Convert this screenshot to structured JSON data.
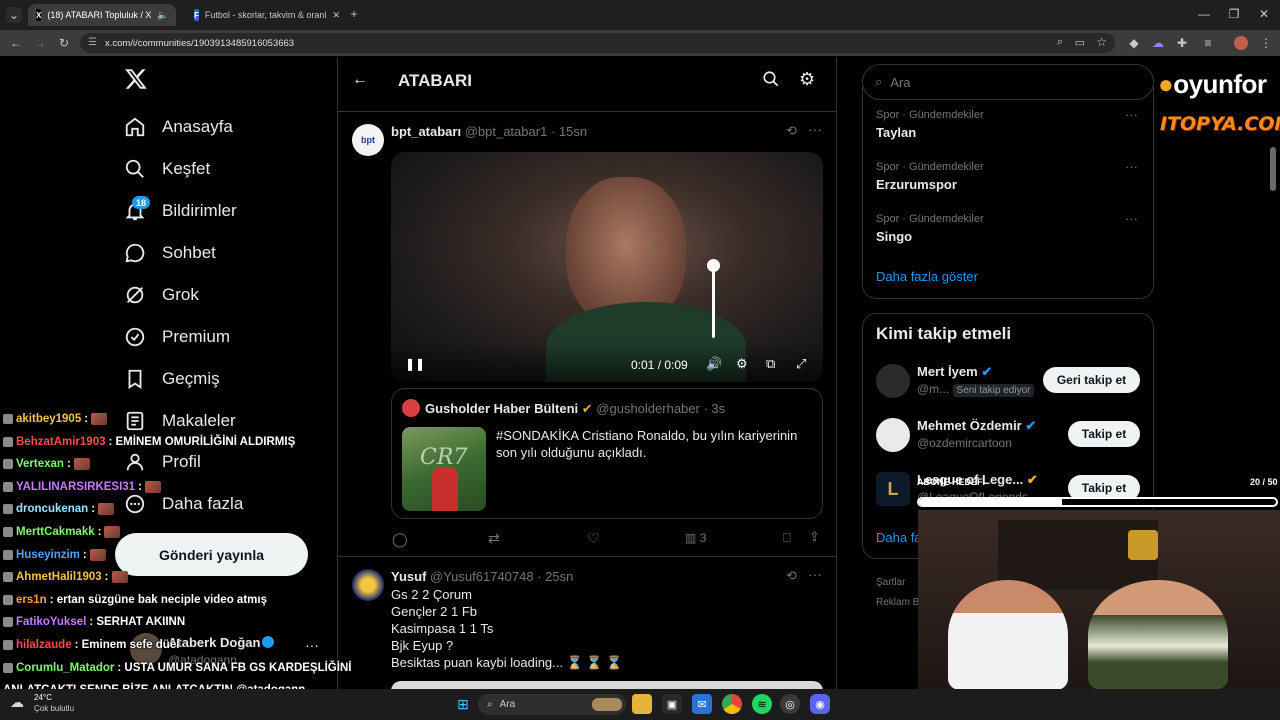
{
  "browser": {
    "tabs": [
      {
        "label": "(18) ATABARI Topluluk / X",
        "active": true
      },
      {
        "label": "Futbol - skorlar, takvim & oranl",
        "active": false
      }
    ],
    "url": "x.com/i/communities/1903913485916053663"
  },
  "sidebar": {
    "items": [
      {
        "label": "Anasayfa",
        "icon": "home-icon"
      },
      {
        "label": "Keşfet",
        "icon": "search-icon"
      },
      {
        "label": "Bildirimler",
        "icon": "bell-icon",
        "badge": "18"
      },
      {
        "label": "Sohbet",
        "icon": "chat-icon"
      },
      {
        "label": "Grok",
        "icon": "grok-icon"
      },
      {
        "label": "Premium",
        "icon": "verified-icon"
      },
      {
        "label": "Geçmiş",
        "icon": "bookmark-icon"
      },
      {
        "label": "Makaleler",
        "icon": "articles-icon"
      },
      {
        "label": "Profil",
        "icon": "person-icon"
      },
      {
        "label": "Daha fazla",
        "icon": "more-circle-icon"
      }
    ],
    "post_button": "Gönderi yayınla",
    "account_name": "Ataberk Doğan",
    "account_handle": "@atadogann"
  },
  "header": {
    "title": "ATABARI"
  },
  "tweets": [
    {
      "author": "bpt_atabarı",
      "handle": "@bpt_atabar1",
      "time": "· 15sn",
      "video_time": "0:01 / 0:09",
      "quote": {
        "author": "Gusholder Haber Bülteni",
        "handle": "@gusholderhaber",
        "time": "· 3s",
        "text": "#SONDAKİKA Cristiano Ronaldo, bu yılın kariyerinin son yılı olduğunu açıkladı."
      },
      "views": "3"
    },
    {
      "author": "Yusuf",
      "handle": "@Yusuf61740748",
      "time": "· 25sn",
      "lines": [
        "Gs 2 2 Çorum",
        "Gençler 2 1 Fb",
        "Kasimpasa 1 1 Ts",
        "Bjk Eyup ?",
        "Besiktas puan kaybi loading... ⌛ ⌛ ⌛"
      ]
    }
  ],
  "right": {
    "search_placeholder": "Ara",
    "trends": [
      {
        "category": "Spor · Gündemdekiler",
        "name": "Taylan"
      },
      {
        "category": "Spor · Gündemdekiler",
        "name": "Erzurumspor"
      },
      {
        "category": "Spor · Gündemdekiler",
        "name": "Singo"
      }
    ],
    "show_more": "Daha fazla göster",
    "who_to_follow_title": "Kimi takip etmeli",
    "follow": [
      {
        "name": "Mert İyem",
        "handle": "@m...",
        "tag": "Seni takip ediyor",
        "button": "Geri takip et"
      },
      {
        "name": "Mehmet Özdemir",
        "handle": "@ozdemircartoon",
        "button": "Takip et"
      },
      {
        "name": "League of Lege...",
        "handle": "@LeagueOfLegends",
        "button": "Takip et"
      }
    ],
    "show_more_2": "Daha fa",
    "footer_1": "Şartlar",
    "footer_2": "Reklam Bi"
  },
  "overlay": {
    "brand_1": "oyunfor",
    "brand_2": "ITOPYA.COM",
    "sub_goal_label": "ABONE HEDEFİ",
    "sub_goal_count": "20 / 50",
    "sub_goal_progress": 0.4,
    "chat": [
      {
        "user": "akitbey1905",
        "color": "#f5c542",
        "msg": ":"
      },
      {
        "user": "BehzatAmir1903",
        "color": "#ff4d4d",
        "msg": ": EMİNEM OMURİLİĞİNİ ALDIRMIŞ"
      },
      {
        "user": "Vertexan",
        "color": "#7cfc6a",
        "msg": ":"
      },
      {
        "user": "YALILINARSIRKESI31",
        "color": "#c77dff",
        "msg": ":"
      },
      {
        "user": "droncukenan",
        "color": "#9be7ff",
        "msg": ":"
      },
      {
        "user": "MerttCakmakk",
        "color": "#7cfc6a",
        "msg": ":"
      },
      {
        "user": "Huseyinzim",
        "color": "#4da3ff",
        "msg": ":"
      },
      {
        "user": "AhmetHalil1903",
        "color": "#f5c542",
        "msg": ":"
      },
      {
        "user": "ers1n",
        "color": "#ff9f43",
        "msg": ": ertan süzgüne bak neciple video atmış"
      },
      {
        "user": "FatikoYuksel",
        "color": "#c77dff",
        "msg": ": SERHAT AKIINN"
      },
      {
        "user": "hilalzaude",
        "color": "#ff4d4d",
        "msg": ": Eminem sefe düel"
      },
      {
        "user": "Corumlu_Matador",
        "color": "#7cfc6a",
        "msg": ": USTA UMUR SANA FB GS KARDEŞLİĞİNİ"
      },
      {
        "user": "",
        "color": "#ffffff",
        "msg": "ANLATCAKTI SENDE BİZE ANLATCAKTIN @atadogann"
      }
    ]
  },
  "taskbar": {
    "weather_temp": "24°C",
    "weather_desc": "Çok bulutlu",
    "search": "Ara"
  }
}
